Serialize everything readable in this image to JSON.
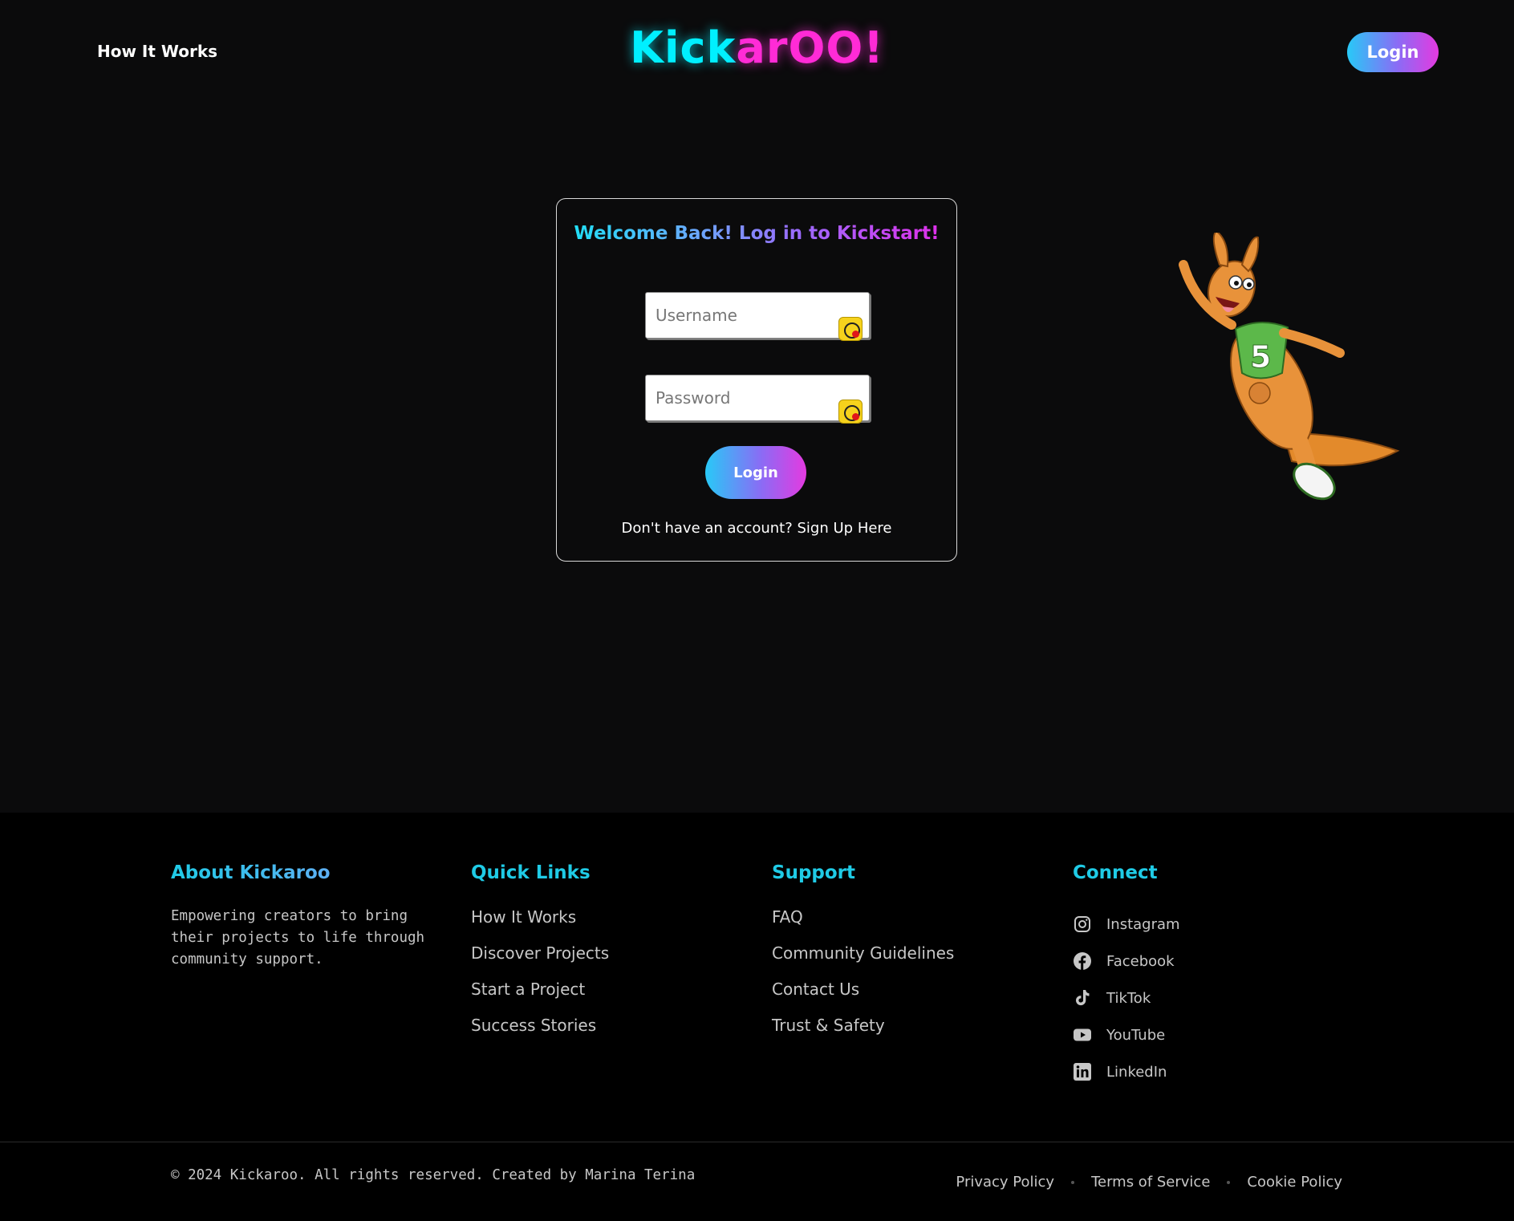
{
  "header": {
    "nav_link": "How It Works",
    "logo_part1": "Kick",
    "logo_part2": "arOO!",
    "login_label": "Login"
  },
  "login_card": {
    "title": "Welcome Back! Log in to Kickstart!",
    "username_placeholder": "Username",
    "password_placeholder": "Password",
    "login_label": "Login",
    "signup_text": "Don't have an account? Sign Up Here"
  },
  "footer": {
    "about": {
      "heading": "About Kickaroo",
      "text": "Empowering creators to bring their projects to life through community support."
    },
    "quick_links": {
      "heading": "Quick Links",
      "items": [
        "How It Works",
        "Discover Projects",
        "Start a Project",
        "Success Stories"
      ]
    },
    "support": {
      "heading": "Support",
      "items": [
        "FAQ",
        "Community Guidelines",
        "Contact Us",
        "Trust & Safety"
      ]
    },
    "connect": {
      "heading": "Connect",
      "items": [
        {
          "label": "Instagram",
          "icon": "instagram-icon"
        },
        {
          "label": "Facebook",
          "icon": "facebook-icon"
        },
        {
          "label": "TikTok",
          "icon": "tiktok-icon"
        },
        {
          "label": "YouTube",
          "icon": "youtube-icon"
        },
        {
          "label": "LinkedIn",
          "icon": "linkedin-icon"
        }
      ]
    },
    "copyright": "© 2024 Kickaroo. All rights reserved. Created by Marina Terina",
    "legal": [
      "Privacy Policy",
      "Terms of Service",
      "Cookie Policy"
    ]
  },
  "colors": {
    "background": "#0b0b0c",
    "footer_background": "#000000",
    "accent_cyan": "#00f0ff",
    "accent_magenta": "#ff2bd6",
    "footer_heading": "#1fcbe6"
  }
}
